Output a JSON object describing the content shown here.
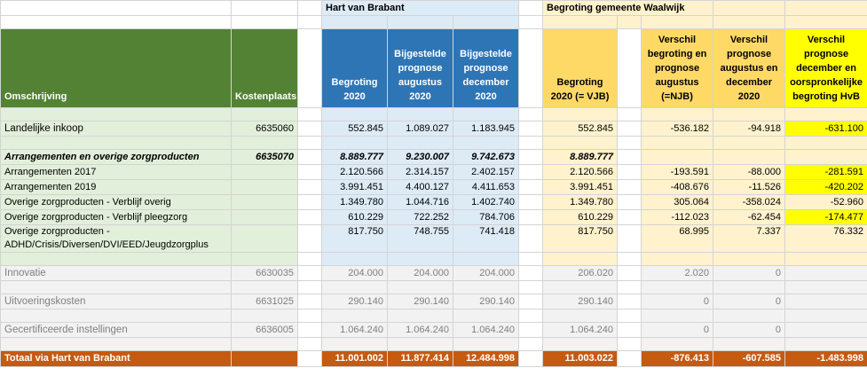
{
  "headers": {
    "group_hvb": "Hart van Brabant",
    "group_waalwijk": "Begroting gemeente Waalwijk",
    "omschrijving": "Omschrijving",
    "kostenplaats": "Kostenplaats",
    "begroting_2020": "Begroting 2020",
    "prognose_aug": "Bijgestelde prognose augustus 2020",
    "prognose_dec": "Bijgestelde prognose december 2020",
    "begroting_vjb": "Begroting 2020 (= VJB)",
    "verschil_aug": "Verschil begroting en prognose augustus (=NJB)",
    "verschil_dec": "Verschil prognose augustus en december 2020",
    "verschil_hvb": "Verschil prognose december en oorspronkelijke begroting HvB"
  },
  "rows": {
    "landelijk": {
      "label": "Landelijke inkoop",
      "kp": "6635060",
      "b": "552.845",
      "pa": "1.089.027",
      "pd": "1.183.945",
      "v": "552.845",
      "d1": "-536.182",
      "d2": "-94.918",
      "d3": "-631.100"
    },
    "arr": {
      "label": "Arrangementen en overige zorgproducten",
      "kp": "6635070",
      "b": "8.889.777",
      "pa": "9.230.007",
      "pd": "9.742.673",
      "v": "8.889.777"
    },
    "arr2017": {
      "label": "Arrangementen 2017",
      "b": "2.120.566",
      "pa": "2.314.157",
      "pd": "2.402.157",
      "v": "2.120.566",
      "d1": "-193.591",
      "d2": "-88.000",
      "d3": "-281.591"
    },
    "arr2019": {
      "label": "Arrangementen 2019",
      "b": "3.991.451",
      "pa": "4.400.127",
      "pd": "4.411.653",
      "v": "3.991.451",
      "d1": "-408.676",
      "d2": "-11.526",
      "d3": "-420.202"
    },
    "verblijf": {
      "label": "Overige zorgproducten - Verblijf overig",
      "b": "1.349.780",
      "pa": "1.044.716",
      "pd": "1.402.740",
      "v": "1.349.780",
      "d1": "305.064",
      "d2": "-358.024",
      "d3": "-52.960"
    },
    "pleeg": {
      "label": "Overige zorgproducten - Verblijf pleegzorg",
      "b": "610.229",
      "pa": "722.252",
      "pd": "784.706",
      "v": "610.229",
      "d1": "-112.023",
      "d2": "-62.454",
      "d3": "-174.477"
    },
    "adhd": {
      "label1": "Overige zorgproducten -",
      "label2": "ADHD/Crisis/Diversen/DVI/EED/Jeugdzorgplus",
      "b": "817.750",
      "pa": "748.755",
      "pd": "741.418",
      "v": "817.750",
      "d1": "68.995",
      "d2": "7.337",
      "d3": "76.332"
    },
    "innovatie": {
      "label": "Innovatie",
      "kp": "6630035",
      "b": "204.000",
      "pa": "204.000",
      "pd": "204.000",
      "v": "206.020",
      "d1": "2.020",
      "d2": "0"
    },
    "uitvoering": {
      "label": "Uitvoeringskosten",
      "kp": "6631025",
      "b": "290.140",
      "pa": "290.140",
      "pd": "290.140",
      "v": "290.140",
      "d1": "0",
      "d2": "0"
    },
    "gecert": {
      "label": "Gecertificeerde instellingen",
      "kp": "6636005",
      "b": "1.064.240",
      "pa": "1.064.240",
      "pd": "1.064.240",
      "v": "1.064.240",
      "d1": "0",
      "d2": "0"
    },
    "totaal": {
      "label": "Totaal via Hart van Brabant",
      "b": "11.001.002",
      "pa": "11.877.414",
      "pd": "12.484.998",
      "v": "11.003.022",
      "d1": "-876.413",
      "d2": "-607.585",
      "d3": "-1.483.998"
    }
  },
  "colors": {
    "green_header": "#548235",
    "blue_header": "#2e75b6",
    "gold_header": "#ffd966",
    "highlight": "#ffff00",
    "total_row": "#c55a11"
  }
}
